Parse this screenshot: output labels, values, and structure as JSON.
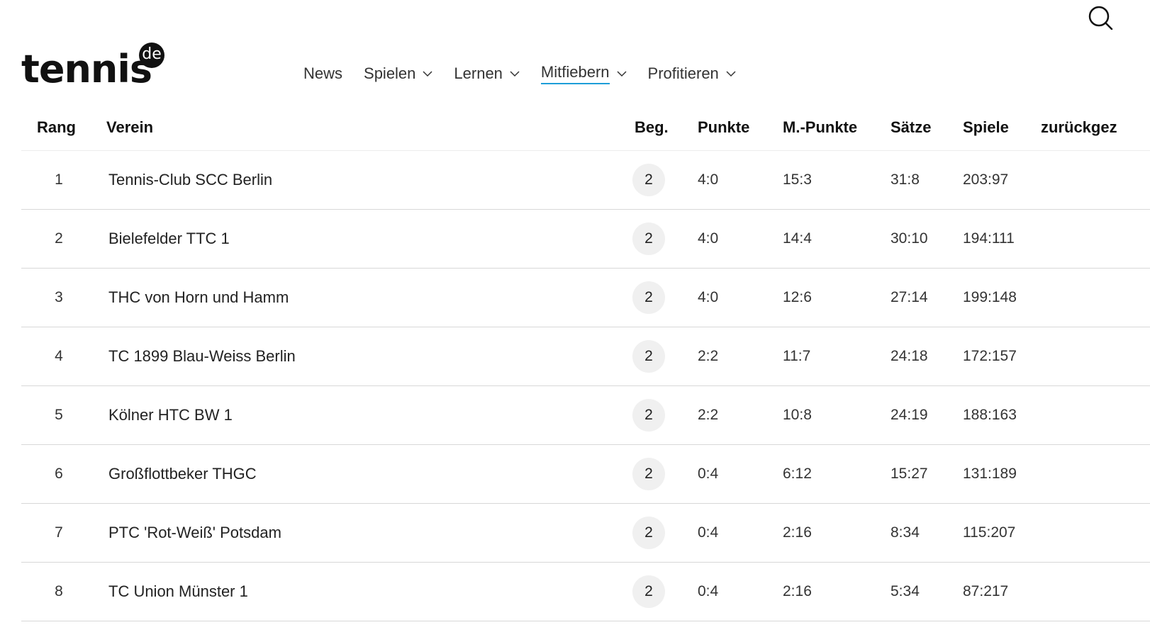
{
  "brand": {
    "name": "tennis",
    "badge": "de"
  },
  "nav": [
    {
      "label": "News",
      "dropdown": false,
      "active": false
    },
    {
      "label": "Spielen",
      "dropdown": true,
      "active": false
    },
    {
      "label": "Lernen",
      "dropdown": true,
      "active": false
    },
    {
      "label": "Mitfiebern",
      "dropdown": true,
      "active": true
    },
    {
      "label": "Profitieren",
      "dropdown": true,
      "active": false
    }
  ],
  "search": {
    "icon": "search-icon"
  },
  "accent_color": "#1e9ed8",
  "table": {
    "headers": {
      "rang": "Rang",
      "verein": "Verein",
      "beg": "Beg.",
      "punkte": "Punkte",
      "mpunkte": "M.-Punkte",
      "saetze": "Sätze",
      "spiele": "Spiele",
      "zurueck": "zurückgez"
    },
    "rows": [
      {
        "rang": "1",
        "verein": "Tennis-Club SCC Berlin",
        "beg": "2",
        "punkte": "4:0",
        "mpunkte": "15:3",
        "saetze": "31:8",
        "spiele": "203:97"
      },
      {
        "rang": "2",
        "verein": "Bielefelder TTC 1",
        "beg": "2",
        "punkte": "4:0",
        "mpunkte": "14:4",
        "saetze": "30:10",
        "spiele": "194:111"
      },
      {
        "rang": "3",
        "verein": "THC von Horn und Hamm",
        "beg": "2",
        "punkte": "4:0",
        "mpunkte": "12:6",
        "saetze": "27:14",
        "spiele": "199:148"
      },
      {
        "rang": "4",
        "verein": "TC 1899 Blau-Weiss Berlin",
        "beg": "2",
        "punkte": "2:2",
        "mpunkte": "11:7",
        "saetze": "24:18",
        "spiele": "172:157"
      },
      {
        "rang": "5",
        "verein": "Kölner HTC BW 1",
        "beg": "2",
        "punkte": "2:2",
        "mpunkte": "10:8",
        "saetze": "24:19",
        "spiele": "188:163"
      },
      {
        "rang": "6",
        "verein": "Großflottbeker THGC",
        "beg": "2",
        "punkte": "0:4",
        "mpunkte": "6:12",
        "saetze": "15:27",
        "spiele": "131:189"
      },
      {
        "rang": "7",
        "verein": "PTC 'Rot-Weiß' Potsdam",
        "beg": "2",
        "punkte": "0:4",
        "mpunkte": "2:16",
        "saetze": "8:34",
        "spiele": "115:207"
      },
      {
        "rang": "8",
        "verein": "TC Union Münster 1",
        "beg": "2",
        "punkte": "0:4",
        "mpunkte": "2:16",
        "saetze": "5:34",
        "spiele": "87:217"
      }
    ]
  }
}
